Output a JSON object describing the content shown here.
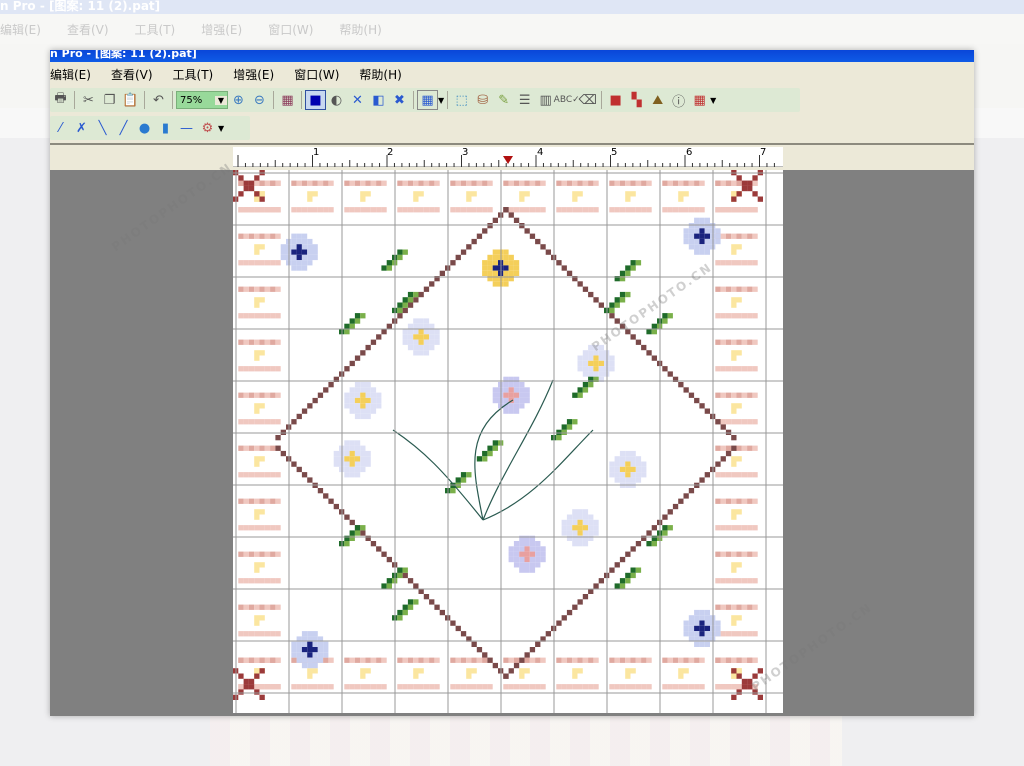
{
  "window_title": "n Pro  - [图案: 11 (2).pat]",
  "menu": [
    "编辑(E)",
    "查看(V)",
    "工具(T)",
    "增强(E)",
    "窗口(W)",
    "帮助(H)"
  ],
  "toolbar": {
    "zoom_value": "75%",
    "row1_icons": [
      "print-icon",
      "cut-icon",
      "copy-icon",
      "paste-icon",
      "undo-icon",
      "zoom-in-icon",
      "zoom-out-icon",
      "palette-icon",
      "full-stitch-icon",
      "half-stitch-icon",
      "cross-icon",
      "three-quarter-icon",
      "x-stitch-icon",
      "grid-icon",
      "select-icon",
      "fill-icon",
      "brush-icon",
      "rows-icon",
      "columns-icon",
      "spellcheck-icon",
      "eraser-icon",
      "pattern-icon",
      "blocks-icon",
      "chart-icon",
      "info-icon",
      "settings-icon"
    ],
    "row2_icons": [
      "needle-icon",
      "french-knot-icon",
      "backstitch-icon",
      "line-icon",
      "bead-icon",
      "capsule-icon",
      "dash-icon",
      "gear-icon"
    ]
  },
  "ruler": {
    "labels": [
      "1",
      "2",
      "3",
      "4",
      "5",
      "6",
      "7"
    ]
  },
  "watermark": "PHOTOPHOTO.CN",
  "colors": {
    "titlebar": "#0a46d8",
    "border_pink": "#e0a9a0",
    "dark_red": "#9b3a3a",
    "leaf_green": "#1f6b2a",
    "blue": "#1a237e",
    "yellow": "#f4cf5a"
  }
}
